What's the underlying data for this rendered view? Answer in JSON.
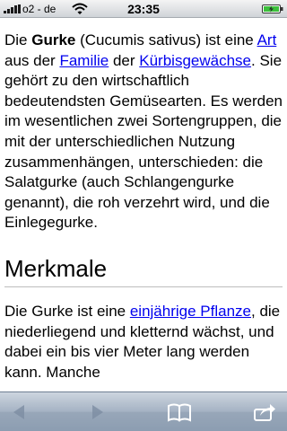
{
  "status_bar": {
    "carrier": "o2 - de",
    "time": "23:35"
  },
  "article": {
    "intro": {
      "t1": "Die ",
      "bold": "Gurke",
      "t2": " (Cucumis sativus) ist eine ",
      "link_art": "Art",
      "t3": " aus der ",
      "link_familie": "Familie",
      "t4": " der ",
      "link_kuerbis": "Kürbisgewächse",
      "t5": ". Sie gehört zu den wirtschaftlich bedeutendsten Gemüsearten. Es werden im wesentlichen zwei Sortengruppen, die mit der unterschiedlichen Nutzung zusammenhängen, unterschieden: die Salatgurke (auch Schlangengurke genannt), die roh verzehrt wird, und die Einlegegurke."
    },
    "section_title": "Merkmale",
    "section_text": {
      "t1": "Die Gurke ist eine ",
      "link": "einjährige Pflanze",
      "t2": ", die niederliegend und kletternd wächst, und dabei ein bis vier Meter lang werden kann. Manche"
    }
  },
  "toolbar": {
    "icons": [
      "back-arrow-icon",
      "forward-arrow-icon",
      "bookmarks-book-icon",
      "share-arrow-icon"
    ]
  },
  "colors": {
    "link": "#0000ee",
    "toolbar": "#a4b2c3"
  }
}
